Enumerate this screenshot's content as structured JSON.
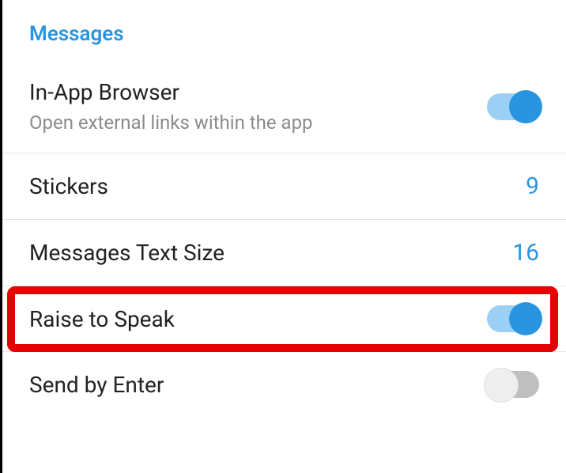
{
  "section": {
    "title": "Messages"
  },
  "settings": {
    "inAppBrowser": {
      "title": "In-App Browser",
      "subtitle": "Open external links within the app",
      "toggle": true
    },
    "stickers": {
      "title": "Stickers",
      "value": "9"
    },
    "textSize": {
      "title": "Messages Text Size",
      "value": "16"
    },
    "raiseToSpeak": {
      "title": "Raise to Speak",
      "toggle": true
    },
    "sendByEnter": {
      "title": "Send by Enter",
      "toggle": false
    }
  }
}
